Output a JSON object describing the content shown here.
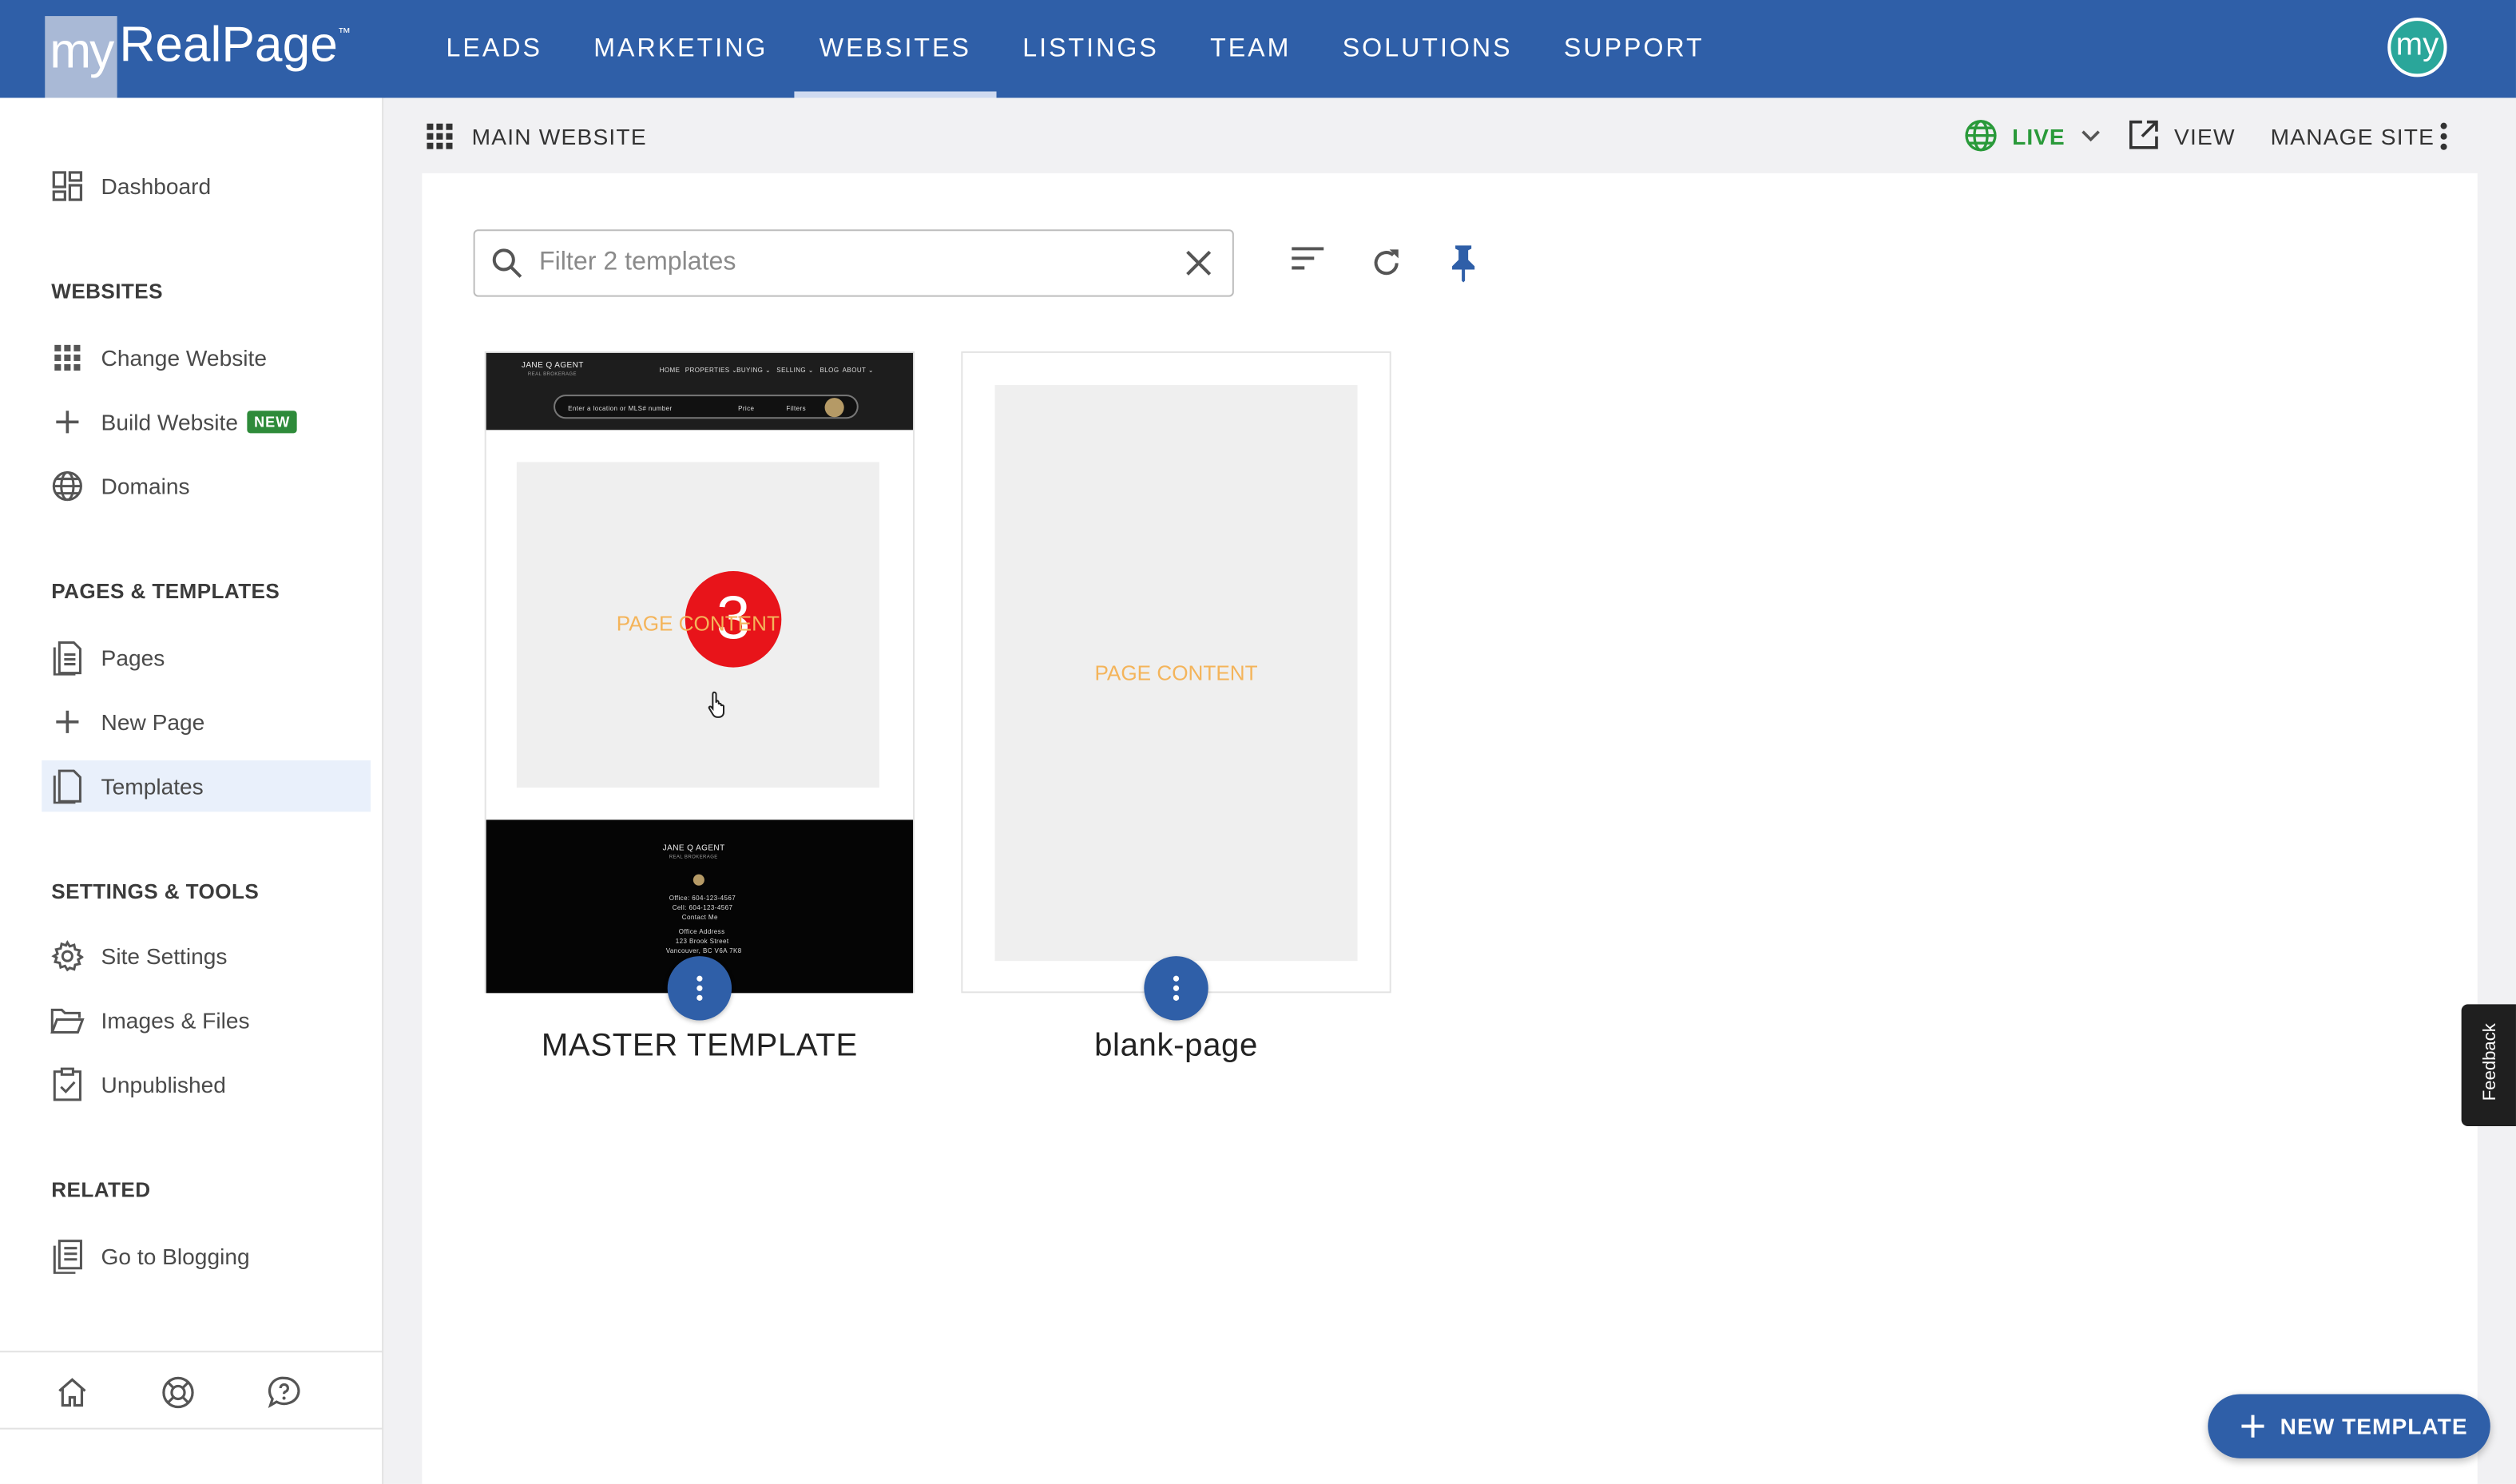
{
  "topbar": {
    "logo_my": "my",
    "logo_name": "RealPage",
    "logo_tm": "™",
    "nav": [
      "LEADS",
      "MARKETING",
      "WEBSITES",
      "LISTINGS",
      "TEAM",
      "SOLUTIONS",
      "SUPPORT"
    ],
    "active_nav": "WEBSITES",
    "avatar": "my"
  },
  "sidebar": {
    "dashboard": "Dashboard",
    "websites_heading": "WEBSITES",
    "change_website": "Change Website",
    "build_website": "Build Website",
    "build_badge": "NEW",
    "domains": "Domains",
    "pages_heading": "PAGES & TEMPLATES",
    "pages": "Pages",
    "new_page": "New Page",
    "templates": "Templates",
    "settings_heading": "SETTINGS & TOOLS",
    "site_settings": "Site Settings",
    "images_files": "Images & Files",
    "unpublished": "Unpublished",
    "related_heading": "RELATED",
    "go_blogging": "Go to Blogging",
    "bottom_icons": [
      "home-icon",
      "lifebuoy-icon",
      "help-chat-icon"
    ]
  },
  "subheader": {
    "title": "MAIN WEBSITE",
    "status": "LIVE",
    "view": "VIEW",
    "manage": "MANAGE SITE"
  },
  "filter": {
    "placeholder": "Filter 2 templates",
    "value": ""
  },
  "templates": [
    {
      "name": "MASTER TEMPLATE",
      "content_label": "PAGE CONTENT",
      "badge": "3",
      "preview": {
        "agent": "JANE Q AGENT",
        "sub": "REAL BROKERAGE",
        "menu": [
          "HOME",
          "PROPERTIES ⌄",
          "BUYING ⌄",
          "SELLING ⌄",
          "BLOG",
          "ABOUT ⌄"
        ],
        "search_placeholder": "Enter a location or MLS# number",
        "price": "Price",
        "filters": "Filters",
        "footer_lines": [
          "Office: 604-123-4567",
          "Cell: 604-123-4567",
          "Contact Me",
          "Office Address",
          "123 Brook Street",
          "Vancouver, BC V6A 7K8"
        ]
      }
    },
    {
      "name": "blank-page",
      "content_label": "PAGE CONTENT"
    }
  ],
  "fab": {
    "label": "NEW TEMPLATE"
  },
  "feedback": "Feedback",
  "colors": {
    "brand": "#2f5fa8",
    "live": "#2a9a3a",
    "badge_new": "#2e8b3a",
    "content_label": "#f4b45a",
    "alert_badge": "#e8141a"
  }
}
